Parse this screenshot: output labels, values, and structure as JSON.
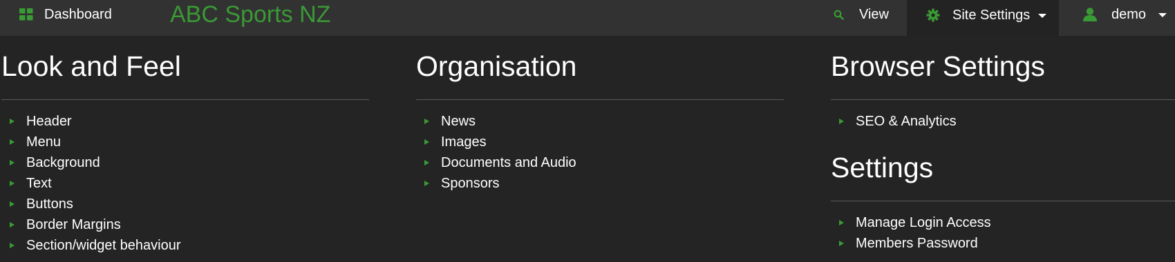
{
  "topbar": {
    "dashboard_label": "Dashboard",
    "brand": "ABC Sports NZ",
    "view_label": "View",
    "site_settings_label": "Site Settings",
    "user_label": "demo",
    "accent_color": "#3a9a35"
  },
  "sections": {
    "look_and_feel": {
      "title": "Look and Feel",
      "items": [
        "Header",
        "Menu",
        "Background",
        "Text",
        "Buttons",
        "Border Margins",
        "Section/widget behaviour"
      ]
    },
    "organisation": {
      "title": "Organisation",
      "items": [
        "News",
        "Images",
        "Documents and Audio",
        "Sponsors"
      ]
    },
    "browser_settings": {
      "title": "Browser Settings",
      "items": [
        "SEO & Analytics"
      ]
    },
    "settings": {
      "title": "Settings",
      "items": [
        "Manage Login Access",
        "Members Password"
      ]
    }
  },
  "icons": {
    "dashboard": "grid-icon",
    "view": "search-icon",
    "site_settings": "gear-icon",
    "user": "user-icon",
    "bullet": "triangle-right-icon"
  }
}
